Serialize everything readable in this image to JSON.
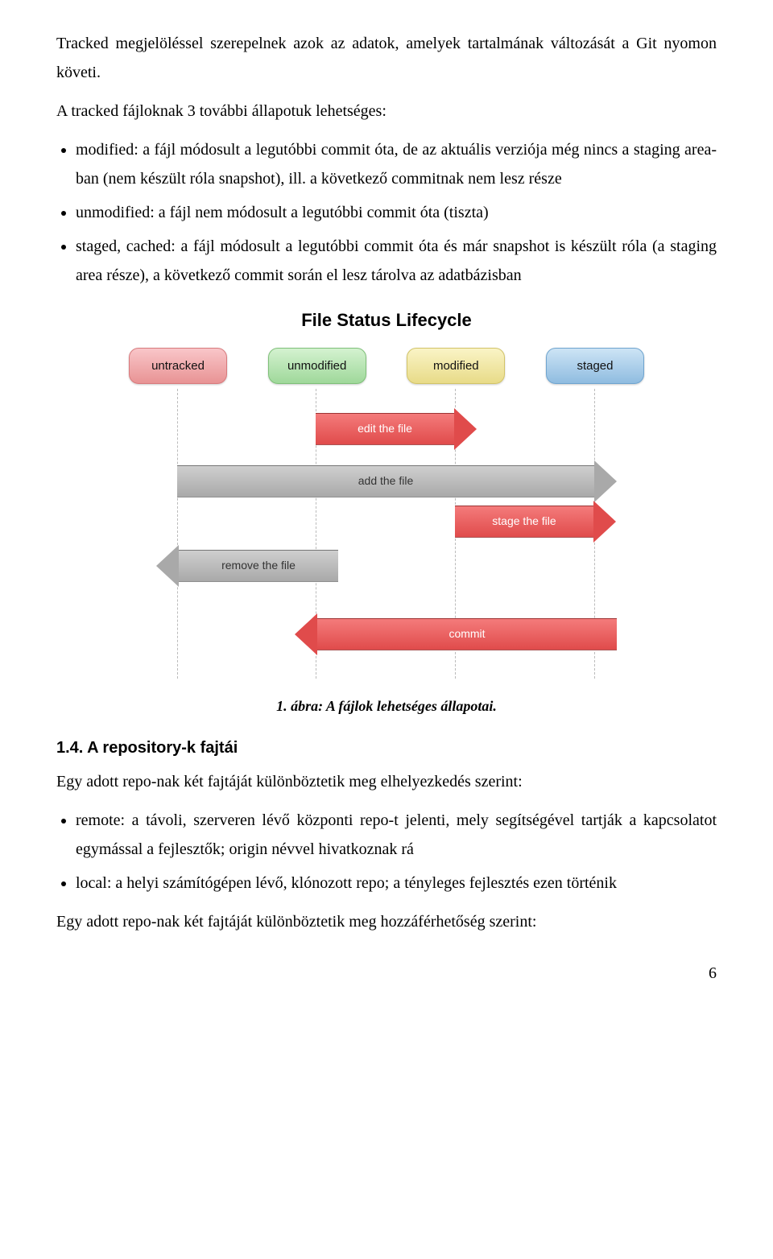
{
  "paragraphs": {
    "intro1": "Tracked megjelöléssel szerepelnek azok az adatok, amelyek tartalmának változását a Git nyomon követi.",
    "intro2": "A tracked fájloknak 3 további állapotuk lehetséges:",
    "bullet1": "modified: a fájl módosult a legutóbbi commit óta, de az aktuális verziója még nincs a staging area-ban (nem készült róla snapshot), ill. a következő commitnak nem lesz része",
    "bullet2": "unmodified: a fájl nem módosult a legutóbbi commit óta (tiszta)",
    "bullet3": "staged, cached: a fájl módosult a legutóbbi commit óta és már snapshot is készült róla (a staging area része), a következő commit során el lesz tárolva az adatbázisban",
    "caption": "1. ábra: A fájlok lehetséges állapotai.",
    "heading14": "1.4. A repository-k fajtái",
    "repo_intro": "Egy adott repo-nak két fajtáját különböztetik meg elhelyezkedés szerint:",
    "repo_bullet1": "remote: a távoli, szerveren lévő központi repo-t jelenti, mely segítségével tartják a kapcsolatot egymással a fejlesztők; origin névvel hivatkoznak rá",
    "repo_bullet2": "local: a helyi számítógépen lévő, klónozott repo; a tényleges fejlesztés ezen történik",
    "repo_access": "Egy adott repo-nak két fajtáját különböztetik meg hozzáférhetőség szerint:"
  },
  "diagram": {
    "title": "File Status Lifecycle",
    "states": {
      "untracked": "untracked",
      "unmodified": "unmodified",
      "modified": "modified",
      "staged": "staged"
    },
    "arrows": {
      "edit": "edit the file",
      "add": "add the file",
      "stage": "stage the file",
      "remove": "remove the file",
      "commit": "commit"
    }
  },
  "page_number": "6",
  "chart_data": {
    "type": "diagram",
    "title": "File Status Lifecycle",
    "nodes": [
      "untracked",
      "unmodified",
      "modified",
      "staged"
    ],
    "edges": [
      {
        "from": "unmodified",
        "to": "modified",
        "label": "edit the file"
      },
      {
        "from": "untracked",
        "to": "staged",
        "label": "add the file"
      },
      {
        "from": "modified",
        "to": "staged",
        "label": "stage the file"
      },
      {
        "from": "unmodified",
        "to": "untracked",
        "label": "remove the file"
      },
      {
        "from": "staged",
        "to": "unmodified",
        "label": "commit"
      }
    ]
  }
}
